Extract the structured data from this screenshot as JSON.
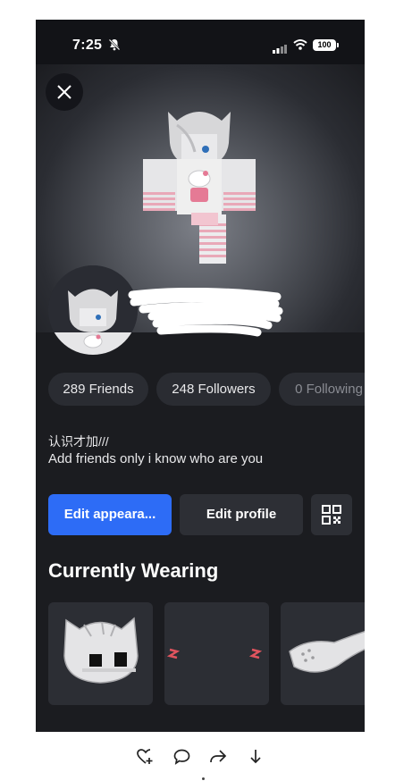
{
  "status_bar": {
    "time": "7:25",
    "battery": "100"
  },
  "header": {
    "close_icon": "close-icon"
  },
  "stats": [
    {
      "label": "289 Friends"
    },
    {
      "label": "248 Followers"
    },
    {
      "label": "0 Following"
    }
  ],
  "bio": {
    "line1": "认识才加///",
    "line2": "Add friends only i know who are you"
  },
  "actions": {
    "edit_appearance": "Edit appeara...",
    "edit_profile": "Edit profile",
    "qr_icon": "qr-code-icon"
  },
  "section": {
    "title": "Currently Wearing"
  },
  "wearing_items": [
    {
      "icon": "cat-head-accessory-icon"
    },
    {
      "icon": "blush-marks-accessory-icon"
    },
    {
      "icon": "mask-accessory-icon"
    }
  ],
  "bottom_bar": {
    "icons": [
      "heart-plus-icon",
      "comment-icon",
      "share-icon",
      "download-icon"
    ]
  },
  "colors": {
    "background": "#1b1c20",
    "accent": "#2d6cf6",
    "pill": "#2a2c32"
  }
}
